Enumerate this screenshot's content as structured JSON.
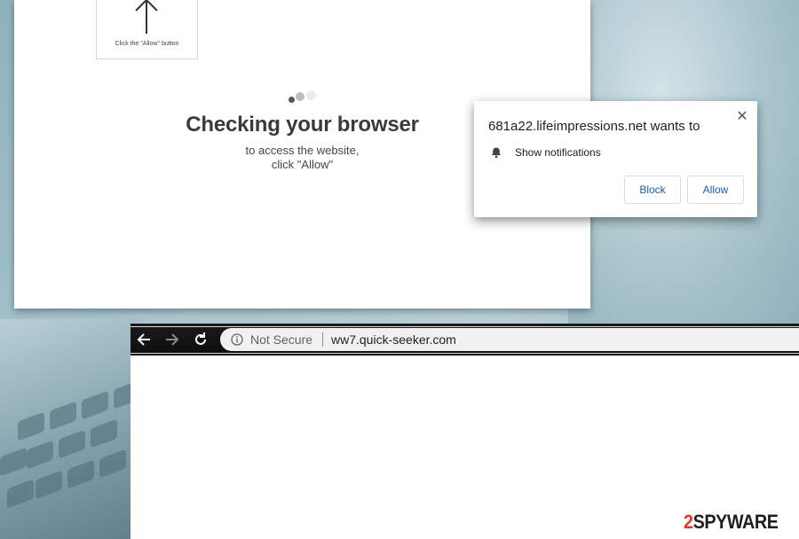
{
  "page": {
    "hint_text": "Click the \"Allow\" button",
    "title": "Checking your browser",
    "subtitle_line1": "to access the website,",
    "subtitle_line2": "click \"Allow\""
  },
  "notification": {
    "site": "681a22.lifeimpressions.net wants to",
    "permission": "Show notifications",
    "block_label": "Block",
    "allow_label": "Allow",
    "close_glyph": "✕"
  },
  "browser": {
    "security_label": "Not Secure",
    "url": "ww7.quick-seeker.com"
  },
  "watermark": {
    "digit": "2",
    "text": "SPYWAR",
    "suffix": "E"
  },
  "colors": {
    "button_text": "#1a5fb4",
    "watermark_accent": "#e03a2f"
  }
}
